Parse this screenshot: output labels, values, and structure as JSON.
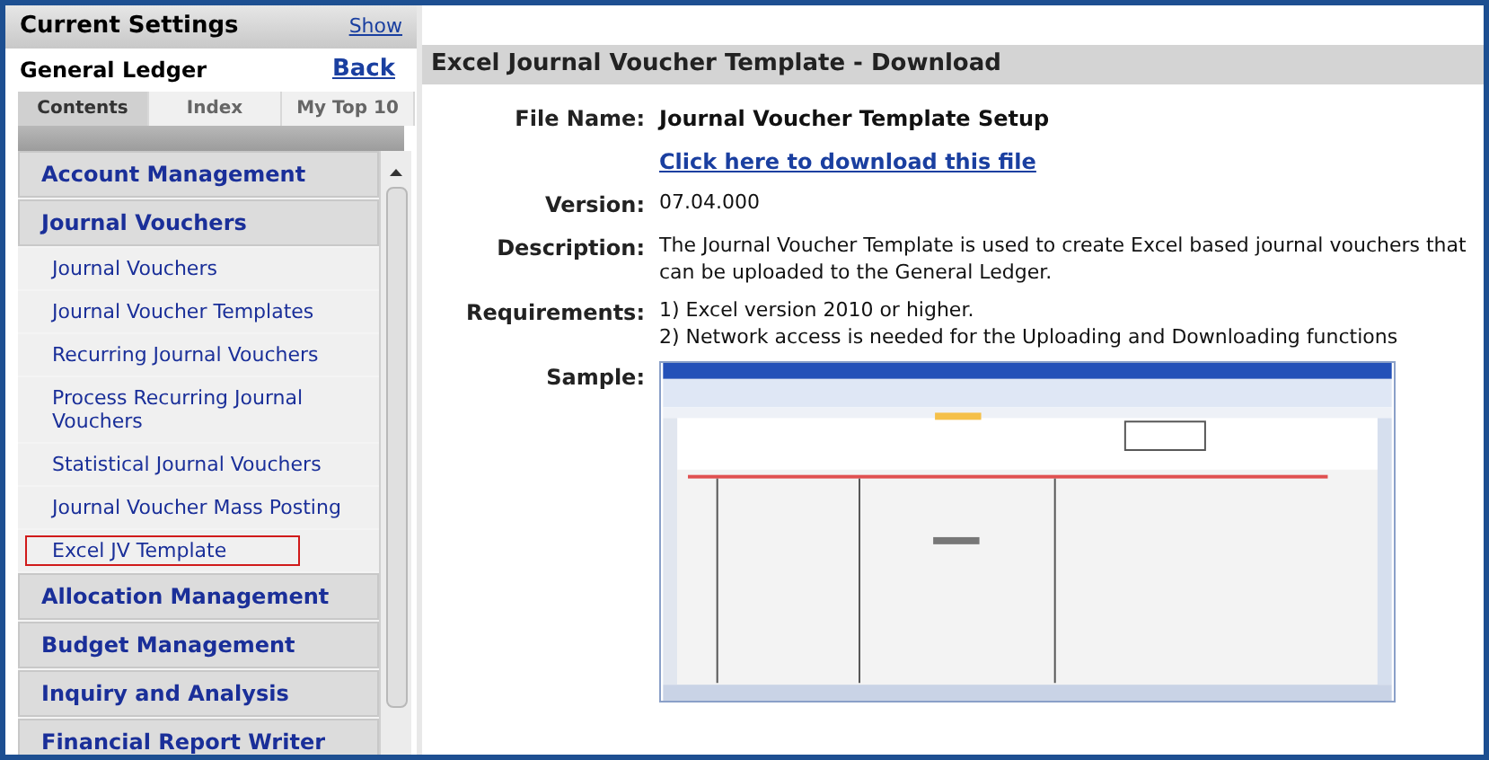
{
  "settings": {
    "title": "Current Settings",
    "show_link": "Show"
  },
  "module": {
    "title": "General Ledger",
    "back_link": "Back"
  },
  "tabs": [
    {
      "label": "Contents",
      "selected": true
    },
    {
      "label": "Index",
      "selected": false
    },
    {
      "label": "My Top 10",
      "selected": false
    }
  ],
  "menu": [
    {
      "label": "Account Management"
    },
    {
      "label": "Journal Vouchers",
      "children": [
        {
          "label": "Journal Vouchers",
          "selected": false
        },
        {
          "label": "Journal Voucher Templates",
          "selected": false
        },
        {
          "label": "Recurring Journal Vouchers",
          "selected": false
        },
        {
          "label": "Process Recurring Journal Vouchers",
          "selected": false
        },
        {
          "label": "Statistical Journal Vouchers",
          "selected": false
        },
        {
          "label": "Journal Voucher Mass Posting",
          "selected": false
        },
        {
          "label": "Excel JV Template",
          "selected": true
        }
      ]
    },
    {
      "label": "Allocation Management"
    },
    {
      "label": "Budget Management"
    },
    {
      "label": "Inquiry and Analysis"
    },
    {
      "label": "Financial Report Writer"
    }
  ],
  "page": {
    "title": "Excel Journal Voucher Template - Download",
    "fields": [
      {
        "kind": "bold",
        "label": "File Name:",
        "lines": [
          "Journal Voucher Template Setup"
        ]
      },
      {
        "kind": "link",
        "lines": [
          "Click here to download this file"
        ]
      },
      {
        "kind": "text",
        "label": "Version:",
        "lines": [
          "07.04.000"
        ]
      },
      {
        "kind": "text",
        "label": "Description:",
        "lines": [
          "The Journal Voucher Template is used to create Excel based journal vouchers that can be uploaded to the General Ledger."
        ]
      },
      {
        "kind": "text",
        "label": "Requirements:",
        "lines": [
          "1) Excel version 2010 or higher.",
          "2) Network access is needed for the Uploading and Downloading functions"
        ]
      },
      {
        "kind": "picture",
        "label": "Sample:"
      }
    ]
  }
}
